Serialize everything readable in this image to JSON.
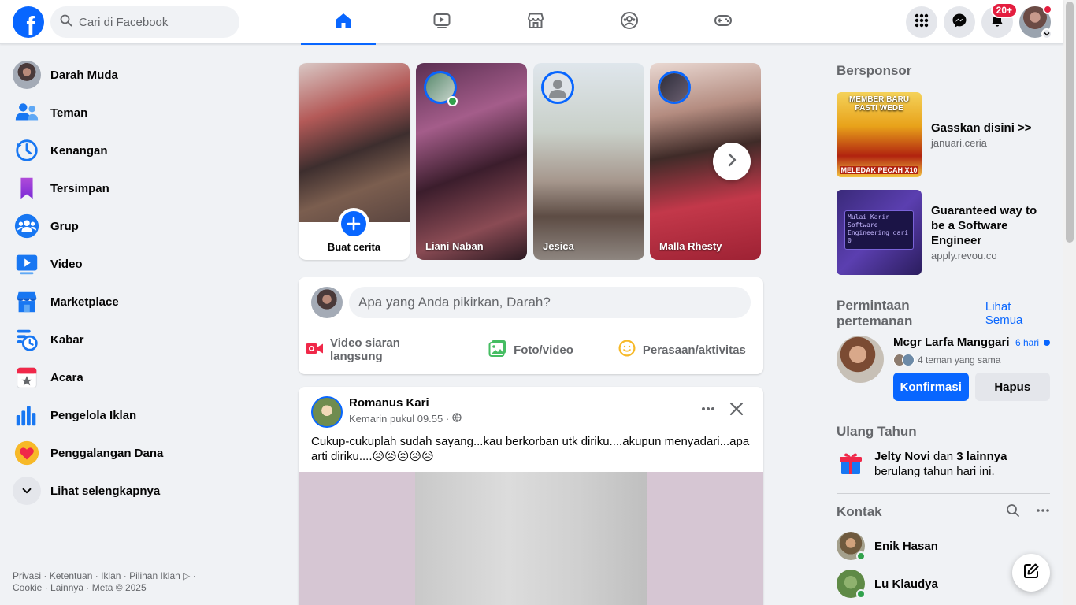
{
  "topbar": {
    "logo_letter": "f",
    "search_placeholder": "Cari di Facebook",
    "tabs": [
      {
        "name": "home",
        "icon": "home-icon",
        "active": true
      },
      {
        "name": "video",
        "icon": "video-tab-icon",
        "active": false
      },
      {
        "name": "marketplace",
        "icon": "marketplace-tab-icon",
        "active": false
      },
      {
        "name": "groups",
        "icon": "groups-tab-icon",
        "active": false
      },
      {
        "name": "gaming",
        "icon": "gaming-tab-icon",
        "active": false
      }
    ],
    "notification_badge": "20+"
  },
  "sidebar": {
    "items": [
      {
        "label": "Darah Muda",
        "icon": "profile-avatar"
      },
      {
        "label": "Teman",
        "icon": "friends-icon"
      },
      {
        "label": "Kenangan",
        "icon": "memories-icon"
      },
      {
        "label": "Tersimpan",
        "icon": "saved-icon"
      },
      {
        "label": "Grup",
        "icon": "groups-icon"
      },
      {
        "label": "Video",
        "icon": "video-icon"
      },
      {
        "label": "Marketplace",
        "icon": "marketplace-icon"
      },
      {
        "label": "Kabar",
        "icon": "feeds-icon"
      },
      {
        "label": "Acara",
        "icon": "events-icon"
      },
      {
        "label": "Pengelola Iklan",
        "icon": "ads-manager-icon"
      },
      {
        "label": "Penggalangan Dana",
        "icon": "fundraiser-icon"
      },
      {
        "label": "Lihat selengkapnya",
        "icon": "chevron-down-icon"
      }
    ],
    "footer": {
      "line1": [
        "Privasi",
        "Ketentuan",
        "Iklan",
        "Pilihan Iklan"
      ],
      "line2": [
        "Cookie",
        "Lainnya",
        "Meta © 2025"
      ]
    }
  },
  "stories": {
    "create_label": "Buat cerita",
    "items": [
      {
        "name": "Liani Naban"
      },
      {
        "name": "Jesica"
      },
      {
        "name": "Malla Rhesty"
      }
    ]
  },
  "composer": {
    "placeholder": "Apa yang Anda pikirkan, Darah?",
    "actions": [
      {
        "label": "Video siaran langsung",
        "color": "#f02849"
      },
      {
        "label": "Foto/video",
        "color": "#45bd62"
      },
      {
        "label": "Perasaan/aktivitas",
        "color": "#f7b928"
      }
    ]
  },
  "post": {
    "author": "Romanus Kari",
    "time": "Kemarin pukul 09.55 ·",
    "text": "Cukup-cukuplah sudah sayang...kau berkorban utk diriku....akupun menyadari...apa arti diriku....😥😥😥😥😥"
  },
  "right": {
    "sponsored_title": "Bersponsor",
    "ads": [
      {
        "title": "Gasskan disini >>",
        "domain": "januari.ceria",
        "image_top": "MEMBER BARU PASTI WEDE",
        "image_bottom": "MELEDAK PECAH X10"
      },
      {
        "title": "Guaranteed way to be a Software Engineer",
        "domain": "apply.revou.co",
        "image_code": "Mulai Karir Software Engineering dari 0"
      }
    ],
    "friend_requests": {
      "title": "Permintaan pertemanan",
      "see_all": "Lihat Semua",
      "name": "Mcgr Larfa Manggari",
      "time": "6 hari",
      "mutual": "4 teman yang sama",
      "confirm": "Konfirmasi",
      "delete": "Hapus"
    },
    "birthdays": {
      "title": "Ulang Tahun",
      "name": "Jelty Novi",
      "connector": " dan ",
      "others": "3 lainnya",
      "suffix": " berulang tahun hari ini."
    },
    "contacts": {
      "title": "Kontak",
      "items": [
        {
          "name": "Enik Hasan"
        },
        {
          "name": "Lu Klaudya"
        }
      ]
    }
  },
  "colors": {
    "brand_blue": "#0866ff",
    "background": "#f0f2f5",
    "online_green": "#31a24c",
    "badge_red": "#e41e3f"
  }
}
